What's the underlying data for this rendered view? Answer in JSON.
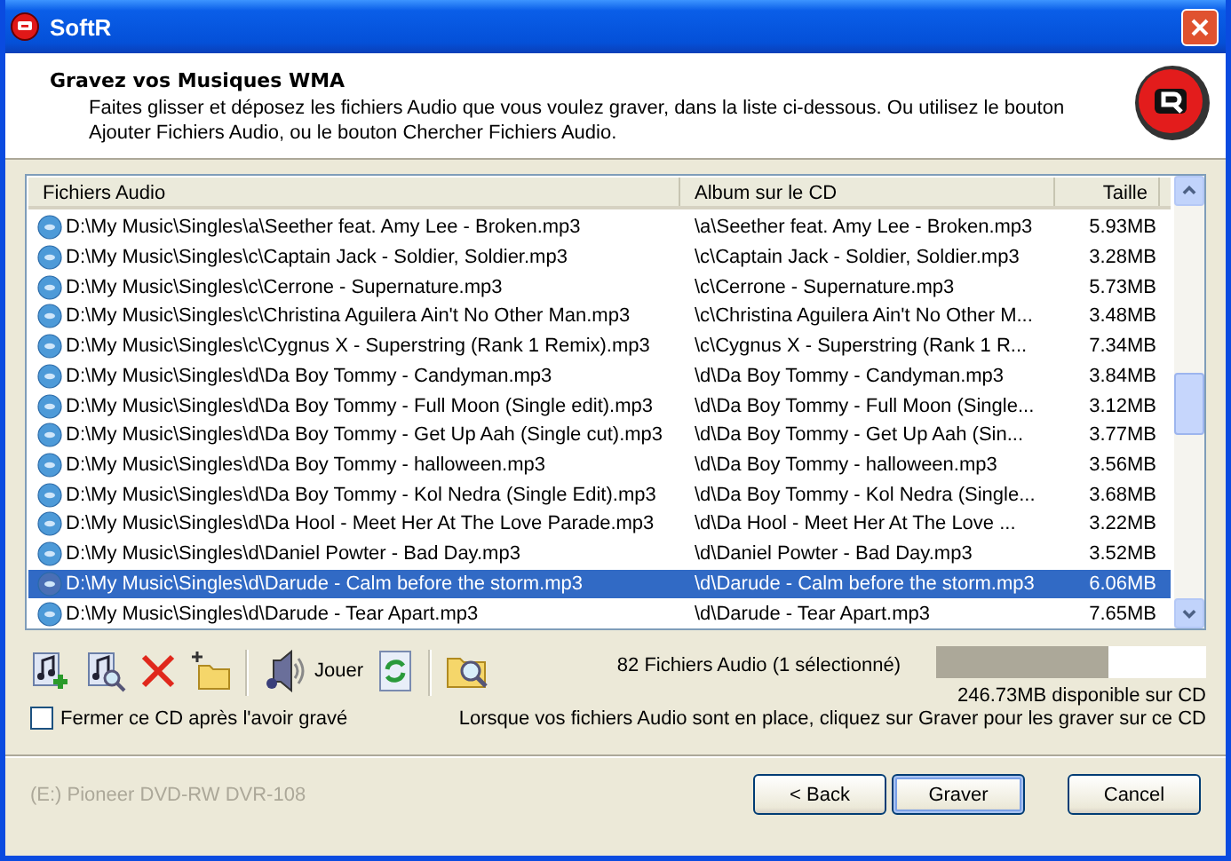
{
  "window": {
    "title": "SoftR"
  },
  "header": {
    "title": "Gravez vos Musiques WMA",
    "description": "Faites glisser et déposez les fichiers Audio que vous voulez graver, dans la liste ci-dessous. Ou utilisez le bouton Ajouter Fichiers Audio, ou le bouton Chercher Fichiers Audio."
  },
  "table": {
    "columns": [
      "Fichiers Audio",
      "Album sur le CD",
      "Taille"
    ],
    "rows": [
      {
        "file": "D:\\My Music\\Singles\\a\\Seether feat. Amy Lee - Broken.mp3",
        "album": "\\a\\Seether feat. Amy Lee - Broken.mp3",
        "size": "5.93MB",
        "selected": false
      },
      {
        "file": "D:\\My Music\\Singles\\c\\Captain Jack - Soldier, Soldier.mp3",
        "album": "\\c\\Captain Jack - Soldier, Soldier.mp3",
        "size": "3.28MB",
        "selected": false
      },
      {
        "file": "D:\\My Music\\Singles\\c\\Cerrone - Supernature.mp3",
        "album": "\\c\\Cerrone - Supernature.mp3",
        "size": "5.73MB",
        "selected": false
      },
      {
        "file": "D:\\My Music\\Singles\\c\\Christina Aguilera Ain't No Other Man.mp3",
        "album": "\\c\\Christina Aguilera Ain't No Other M...",
        "size": "3.48MB",
        "selected": false
      },
      {
        "file": "D:\\My Music\\Singles\\c\\Cygnus X - Superstring (Rank 1 Remix).mp3",
        "album": "\\c\\Cygnus X - Superstring (Rank 1 R...",
        "size": "7.34MB",
        "selected": false
      },
      {
        "file": "D:\\My Music\\Singles\\d\\Da Boy Tommy - Candyman.mp3",
        "album": "\\d\\Da Boy Tommy - Candyman.mp3",
        "size": "3.84MB",
        "selected": false
      },
      {
        "file": "D:\\My Music\\Singles\\d\\Da Boy Tommy - Full Moon (Single edit).mp3",
        "album": "\\d\\Da Boy Tommy - Full Moon (Single...",
        "size": "3.12MB",
        "selected": false
      },
      {
        "file": "D:\\My Music\\Singles\\d\\Da Boy Tommy - Get Up Aah (Single cut).mp3",
        "album": "\\d\\Da Boy Tommy - Get Up Aah (Sin...",
        "size": "3.77MB",
        "selected": false
      },
      {
        "file": "D:\\My Music\\Singles\\d\\Da Boy Tommy - halloween.mp3",
        "album": "\\d\\Da Boy Tommy - halloween.mp3",
        "size": "3.56MB",
        "selected": false
      },
      {
        "file": "D:\\My Music\\Singles\\d\\Da Boy Tommy - Kol Nedra (Single Edit).mp3",
        "album": "\\d\\Da Boy Tommy - Kol Nedra (Single...",
        "size": "3.68MB",
        "selected": false
      },
      {
        "file": "D:\\My Music\\Singles\\d\\Da Hool - Meet Her At The Love Parade.mp3",
        "album": "\\d\\Da Hool - Meet Her At The Love ...",
        "size": "3.22MB",
        "selected": false
      },
      {
        "file": "D:\\My Music\\Singles\\d\\Daniel Powter - Bad Day.mp3",
        "album": "\\d\\Daniel Powter - Bad Day.mp3",
        "size": "3.52MB",
        "selected": false
      },
      {
        "file": "D:\\My Music\\Singles\\d\\Darude - Calm before the storm.mp3",
        "album": "\\d\\Darude - Calm before the storm.mp3",
        "size": "6.06MB",
        "selected": true
      },
      {
        "file": "D:\\My Music\\Singles\\d\\Darude - Tear Apart.mp3",
        "album": "\\d\\Darude - Tear Apart.mp3",
        "size": "7.65MB",
        "selected": false
      }
    ]
  },
  "toolbar": {
    "play_label": "Jouer"
  },
  "summary": {
    "count": "82 Fichiers Audio (1 sélectionné)",
    "level": 0.64,
    "free": "246.73MB disponible sur CD"
  },
  "close_after": {
    "label": "Fermer ce CD après l'avoir gravé",
    "checked": false
  },
  "hint": "Lorsque vos fichiers Audio sont en place, cliquez sur Graver pour les graver sur ce CD",
  "drive": {
    "label": "(E:) Pioneer DVD-RW DVR-108",
    "disabled": true
  },
  "buttons": [
    {
      "label": "< Back",
      "default": false
    },
    {
      "label": "Graver",
      "default": true
    },
    {
      "label": "Cancel",
      "default": false
    }
  ]
}
